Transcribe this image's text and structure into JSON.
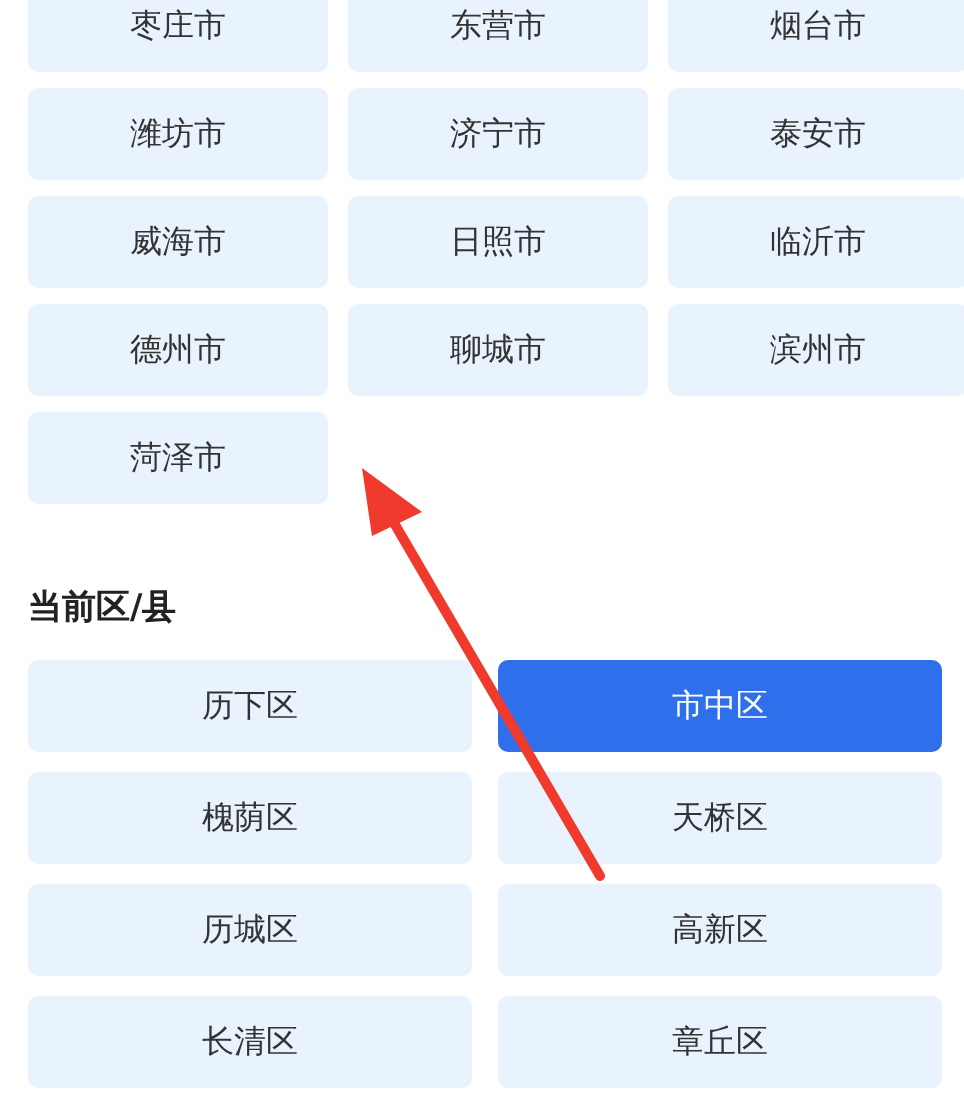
{
  "cities": [
    {
      "name": "枣庄市"
    },
    {
      "name": "东营市"
    },
    {
      "name": "烟台市"
    },
    {
      "name": "潍坊市"
    },
    {
      "name": "济宁市"
    },
    {
      "name": "泰安市"
    },
    {
      "name": "威海市"
    },
    {
      "name": "日照市"
    },
    {
      "name": "临沂市"
    },
    {
      "name": "德州市"
    },
    {
      "name": "聊城市"
    },
    {
      "name": "滨州市"
    },
    {
      "name": "菏泽市"
    }
  ],
  "district_section": {
    "title": "当前区/县"
  },
  "districts": [
    {
      "name": "历下区",
      "selected": false
    },
    {
      "name": "市中区",
      "selected": true
    },
    {
      "name": "槐荫区",
      "selected": false
    },
    {
      "name": "天桥区",
      "selected": false
    },
    {
      "name": "历城区",
      "selected": false
    },
    {
      "name": "高新区",
      "selected": false
    },
    {
      "name": "长清区",
      "selected": false
    },
    {
      "name": "章丘区",
      "selected": false
    }
  ]
}
